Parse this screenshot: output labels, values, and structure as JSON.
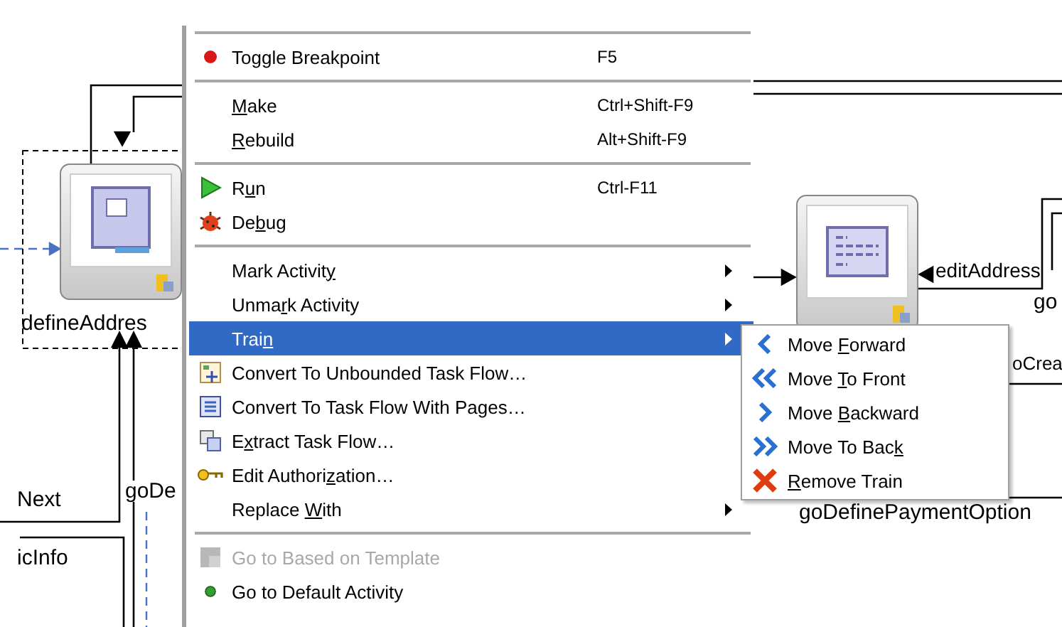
{
  "diagram": {
    "nodes": [
      {
        "label": "defineAddres",
        "kind": "page"
      },
      {
        "kind": "view"
      }
    ],
    "edge_labels": [
      {
        "text": "editAddress",
        "kind": "a"
      },
      {
        "text": "go",
        "kind": "b"
      },
      {
        "text": "oCrea",
        "kind": "c"
      },
      {
        "text": "goDefinePaymentOption",
        "kind": "d"
      },
      {
        "text": "Next",
        "kind": "e"
      },
      {
        "text": "goDe",
        "kind": "f"
      },
      {
        "text": "icInfo",
        "kind": "g"
      }
    ]
  },
  "menu": {
    "items": [
      {
        "kind": "separator"
      },
      {
        "kind": "item",
        "label": "Toggle Breakpoint",
        "shortcut": "F5",
        "submenu": false,
        "disabled": false,
        "selected": false
      },
      {
        "kind": "separator"
      },
      {
        "kind": "item",
        "label": "Make",
        "shortcut": "Ctrl+Shift-F9",
        "submenu": false,
        "disabled": false,
        "selected": false
      },
      {
        "kind": "item",
        "label": "Rebuild",
        "shortcut": "Alt+Shift-F9",
        "submenu": false,
        "disabled": false,
        "selected": false
      },
      {
        "kind": "separator"
      },
      {
        "kind": "item",
        "label": "Run",
        "shortcut": "Ctrl-F11",
        "submenu": false,
        "disabled": false,
        "selected": false
      },
      {
        "kind": "item",
        "label": "Debug",
        "submenu": false,
        "disabled": false,
        "selected": false
      },
      {
        "kind": "separator"
      },
      {
        "kind": "item",
        "label": "Mark Activity",
        "submenu": true,
        "disabled": false,
        "selected": false
      },
      {
        "kind": "item",
        "label": "Unmark Activity",
        "submenu": true,
        "disabled": false,
        "selected": false
      },
      {
        "kind": "item",
        "label": "Train",
        "submenu": true,
        "disabled": false,
        "selected": true
      },
      {
        "kind": "item",
        "label": "Convert To Unbounded Task Flow…",
        "submenu": false,
        "disabled": false,
        "selected": false
      },
      {
        "kind": "item",
        "label": "Convert To Task Flow With Pages…",
        "submenu": false,
        "disabled": false,
        "selected": false
      },
      {
        "kind": "item",
        "label": "Extract Task Flow…",
        "submenu": false,
        "disabled": false,
        "selected": false
      },
      {
        "kind": "item",
        "label": "Edit Authorization…",
        "submenu": false,
        "disabled": false,
        "selected": false
      },
      {
        "kind": "item",
        "label": "Replace With",
        "submenu": true,
        "disabled": false,
        "selected": false
      },
      {
        "kind": "separator"
      },
      {
        "kind": "item",
        "label": "Go to Based on Template",
        "submenu": false,
        "disabled": true,
        "selected": false
      },
      {
        "kind": "item",
        "label": "Go to Default Activity",
        "submenu": false,
        "disabled": false,
        "selected": false
      }
    ]
  },
  "submenu": {
    "items": [
      {
        "label": "Move Forward"
      },
      {
        "label": "Move To Front"
      },
      {
        "label": "Move Backward"
      },
      {
        "label": "Move To Back"
      },
      {
        "label": "Remove Train"
      }
    ]
  }
}
